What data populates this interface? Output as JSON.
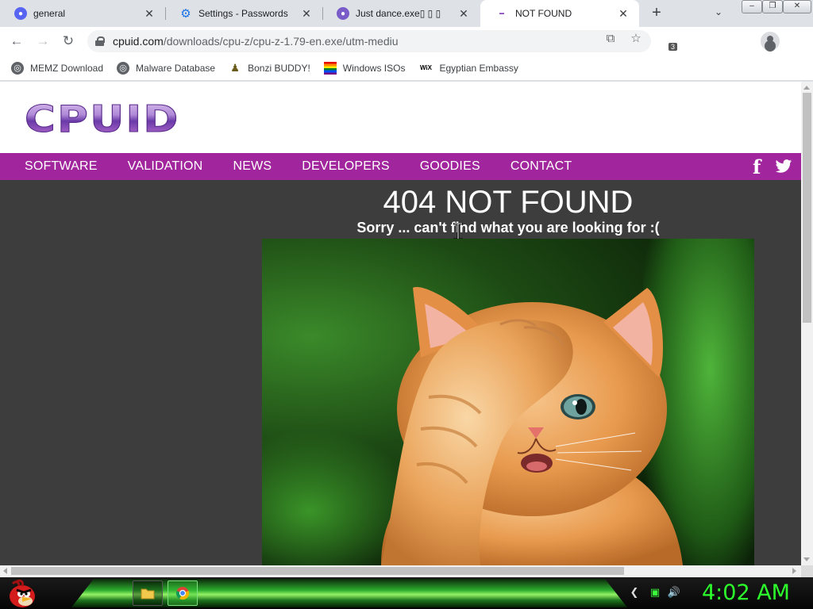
{
  "tabs": [
    {
      "title": "general",
      "icon": "discord-icon"
    },
    {
      "title": "Settings - Passwords",
      "icon": "gear-icon"
    },
    {
      "title": "Just dance.exe▯ ▯ ▯",
      "icon": "app-icon"
    },
    {
      "title": "NOT FOUND",
      "icon": "cpuid-icon"
    }
  ],
  "tab_close_glyph": "✕",
  "new_tab_glyph": "+",
  "window_controls": {
    "minimize": "–",
    "restore": "❐",
    "close": "✕"
  },
  "address_bar": {
    "host": "cpuid.com",
    "path": "/downloads/cpu-z/cpu-z-1.79-en.exe/utm-mediu"
  },
  "extension_badge": "3",
  "bookmarks": [
    {
      "label": "MEMZ Download",
      "icon": "globe-icon"
    },
    {
      "label": "Malware Database",
      "icon": "globe-icon"
    },
    {
      "label": "Bonzi BUDDY!",
      "icon": "bonzi-icon"
    },
    {
      "label": "Windows ISOs",
      "icon": "rainbow-flag-icon"
    },
    {
      "label": "Egyptian Embassy",
      "icon": "wix-icon",
      "icon_text": "WiX"
    }
  ],
  "site": {
    "logo": "CPUID",
    "nav": [
      "SOFTWARE",
      "VALIDATION",
      "NEWS",
      "DEVELOPERS",
      "GOODIES",
      "CONTACT"
    ],
    "social_facebook": "f",
    "error_title": "404 NOT FOUND",
    "error_subtitle": "Sorry ... can't find what you are looking for :(",
    "colors": {
      "nav_bg": "#a1259d",
      "page_bg": "#3d3d3d"
    }
  },
  "taskbar": {
    "clock": "4:02 AM",
    "clock_color": "#2cff2c"
  }
}
